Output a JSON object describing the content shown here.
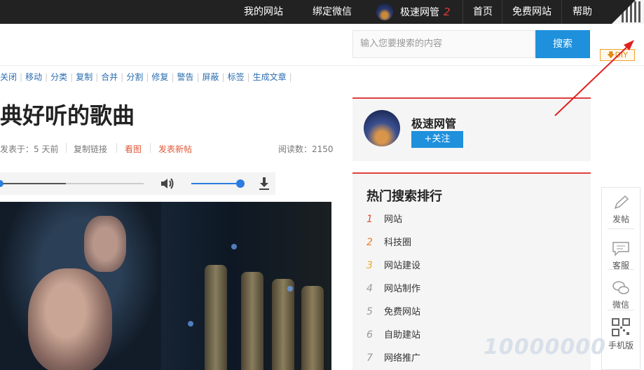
{
  "topbar": {
    "my_sites": "我的网站",
    "bind_wechat": "绑定微信",
    "username": "极速网管",
    "notif_count": "2",
    "home": "首页",
    "free_site": "免费网站",
    "help": "帮助"
  },
  "search": {
    "placeholder": "输入您要搜索的内容",
    "button": "搜索"
  },
  "diy_label": "DIY",
  "admin_actions": [
    "关闭",
    "移动",
    "分类",
    "复制",
    "合并",
    "分割",
    "修复",
    "警告",
    "屏蔽",
    "标签",
    "生成文章"
  ],
  "post": {
    "title": "典好听的歌曲",
    "posted": "发表于：5 天前",
    "copy_link": "复制链接",
    "view_pic": "看图",
    "new_post": "发表新帖",
    "read_count": "阅读数：2150"
  },
  "player": {
    "progress": 0.0,
    "buffered": 0.46,
    "volume": 1.0
  },
  "author_card": {
    "name": "极速网管",
    "follow": "+关注"
  },
  "hot_search": {
    "title": "热门搜索排行",
    "items": [
      {
        "rank": "1",
        "label": "网站",
        "color": "#e0503a"
      },
      {
        "rank": "2",
        "label": "科技圈",
        "color": "#f07a2a"
      },
      {
        "rank": "3",
        "label": "网站建设",
        "color": "#f0a82a"
      },
      {
        "rank": "4",
        "label": "网站制作",
        "color": "#999999"
      },
      {
        "rank": "5",
        "label": "免费网站",
        "color": "#999999"
      },
      {
        "rank": "6",
        "label": "自助建站",
        "color": "#999999"
      },
      {
        "rank": "7",
        "label": "网络推广",
        "color": "#999999"
      }
    ]
  },
  "tools": {
    "post": "发帖",
    "service": "客服",
    "wechat": "微信",
    "mobile": "手机版"
  },
  "watermark": "10000000",
  "colors": {
    "accent": "#1e90dc",
    "topbar": "#222222",
    "card_border": "#e04040",
    "arrow": "#e02020"
  },
  "icons": [
    "pencil-icon",
    "chat-icon",
    "wechat-icon",
    "qrcode-icon",
    "volume-icon",
    "download-icon"
  ]
}
